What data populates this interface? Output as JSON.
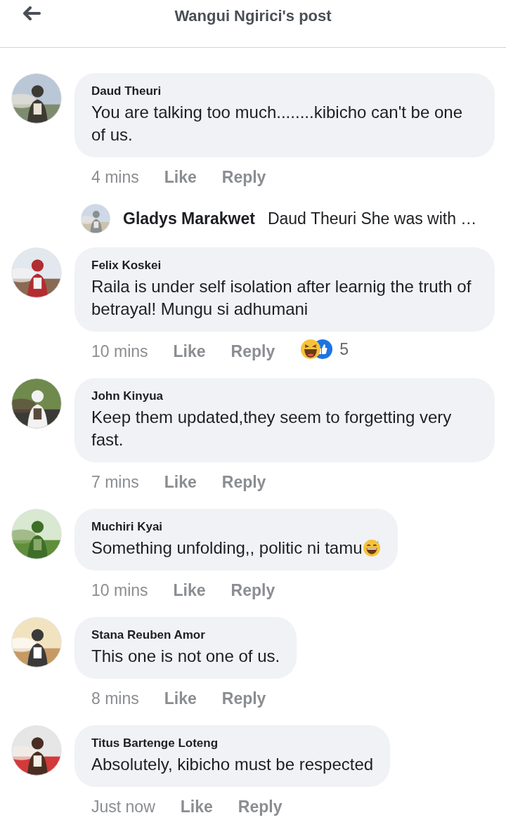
{
  "header": {
    "title": "Wangui Ngirici's post"
  },
  "items": [
    {
      "kind": "comment",
      "name": "Daud Theuri",
      "text": "You are talking too much........kibicho can't be one of us.",
      "time": "4 mins",
      "like": "Like",
      "reply": "Reply"
    },
    {
      "kind": "reply_preview",
      "name": "Gladys Marakwet",
      "text": "Daud Theuri She was with …"
    },
    {
      "kind": "comment",
      "name": "Felix Koskei",
      "text": "Raila is under self isolation after learnig the truth of betrayal! Mungu si adhumani",
      "time": "10 mins",
      "like": "Like",
      "reply": "Reply",
      "reactions": {
        "count": "5"
      }
    },
    {
      "kind": "comment",
      "name": "John Kinyua",
      "text": "Keep them updated,they seem to forgetting very fast.",
      "time": "7 mins",
      "like": "Like",
      "reply": "Reply"
    },
    {
      "kind": "comment",
      "name": "Muchiri Kyai",
      "text": "Something unfolding,, politic ni tamu",
      "emoji": true,
      "time": "10 mins",
      "like": "Like",
      "reply": "Reply"
    },
    {
      "kind": "comment",
      "name": "Stana Reuben Amor",
      "text": "This one is not one of us.",
      "time": "8 mins",
      "like": "Like",
      "reply": "Reply"
    },
    {
      "kind": "comment",
      "name": "Titus Bartenge Loteng",
      "text": "Absolutely, kibicho must be respected",
      "time": "Just now",
      "like": "Like",
      "reply": "Reply"
    }
  ]
}
